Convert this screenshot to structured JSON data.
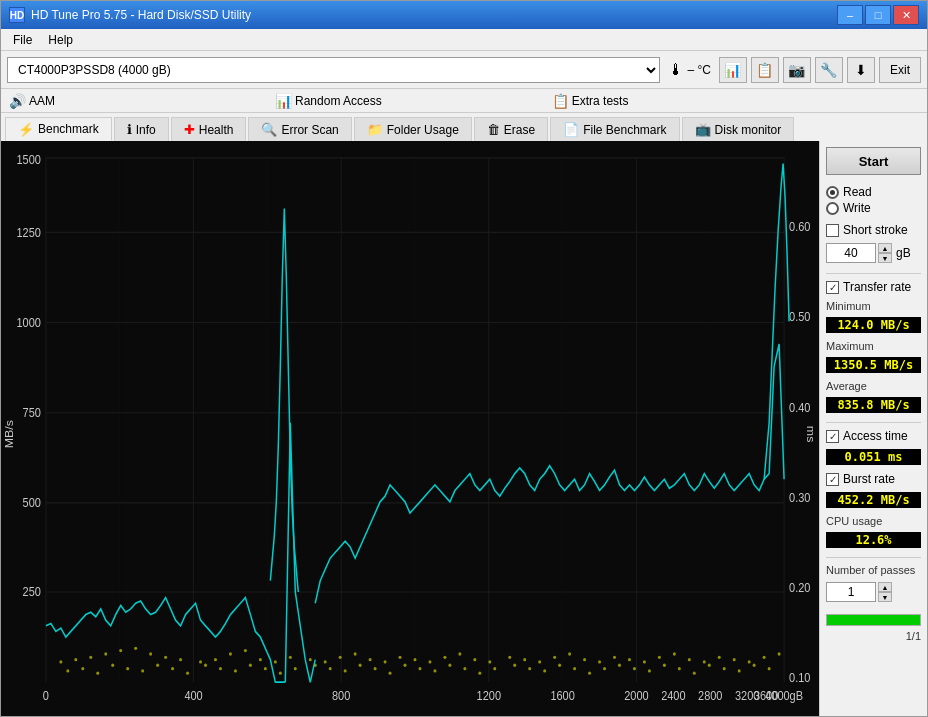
{
  "window": {
    "title": "HD Tune Pro 5.75 - Hard Disk/SSD Utility",
    "icon": "HD"
  },
  "title_buttons": {
    "minimize": "–",
    "maximize": "□",
    "close": "✕"
  },
  "menu": {
    "file": "File",
    "help": "Help"
  },
  "toolbar": {
    "disk_name": "CT4000P3PSSD8 (4000 gB)",
    "temperature": "– °C",
    "exit_label": "Exit"
  },
  "tab_sections": [
    {
      "id": "aam",
      "icon": "🔊",
      "label": "AAM"
    },
    {
      "id": "random-access",
      "icon": "📊",
      "label": "Random Access"
    },
    {
      "id": "extra-tests",
      "icon": "📋",
      "label": "Extra tests"
    }
  ],
  "tabs": [
    {
      "id": "benchmark",
      "icon": "⚡",
      "label": "Benchmark",
      "active": true
    },
    {
      "id": "info",
      "icon": "ℹ",
      "label": "Info",
      "active": false
    },
    {
      "id": "health",
      "icon": "➕",
      "label": "Health",
      "active": false
    },
    {
      "id": "error-scan",
      "icon": "🔍",
      "label": "Error Scan",
      "active": false
    },
    {
      "id": "folder-usage",
      "icon": "📁",
      "label": "Folder Usage",
      "active": false
    },
    {
      "id": "erase",
      "icon": "🗑",
      "label": "Erase",
      "active": false
    },
    {
      "id": "file-benchmark",
      "icon": "📄",
      "label": "File Benchmark",
      "active": false
    },
    {
      "id": "disk-monitor",
      "icon": "📺",
      "label": "Disk monitor",
      "active": false
    }
  ],
  "sidebar": {
    "start_label": "Start",
    "read_label": "Read",
    "write_label": "Write",
    "short_stroke_label": "Short stroke",
    "short_stroke_value": "40",
    "gB_label": "gB",
    "transfer_rate_label": "Transfer rate",
    "access_time_label": "Access time",
    "burst_rate_label": "Burst rate",
    "cpu_usage_label": "CPU usage",
    "stats": {
      "minimum_label": "Minimum",
      "minimum_value": "124.0 MB/s",
      "maximum_label": "Maximum",
      "maximum_value": "1350.5 MB/s",
      "average_label": "Average",
      "average_value": "835.8 MB/s",
      "access_time_value": "0.051 ms",
      "burst_rate_value": "452.2 MB/s",
      "cpu_usage_value": "12.6%"
    },
    "passes_label": "Number of passes",
    "passes_value": "1",
    "progress_text": "1/1",
    "progress_percent": 100
  },
  "chart": {
    "y_axis_left_label": "MB/s",
    "y_axis_right_label": "ms",
    "x_axis_label": "gB",
    "y_ticks_left": [
      250,
      500,
      750,
      1000,
      1250,
      1500
    ],
    "y_ticks_right": [
      0.1,
      0.2,
      0.3,
      0.4,
      0.5,
      0.6
    ],
    "x_ticks": [
      0,
      400,
      800,
      1200,
      1600,
      2000,
      2400,
      2800,
      3200,
      3600,
      4000
    ]
  }
}
